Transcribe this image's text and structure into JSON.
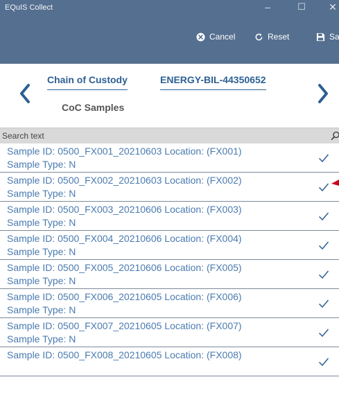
{
  "window": {
    "title": "EQuIS Collect",
    "controls": {
      "minimize": "–",
      "maximize": "☐",
      "close": "✕"
    }
  },
  "toolbar": {
    "cancel_label": "Cancel",
    "reset_label": "Reset",
    "save_label": "Save"
  },
  "header": {
    "tabs": [
      {
        "label": "Chain of Custody"
      },
      {
        "label": "ENERGY-BIL-44350652"
      }
    ],
    "subtitle": "CoC Samples"
  },
  "search": {
    "placeholder": "Search text",
    "value": ""
  },
  "samples": [
    {
      "line1": "Sample ID: 0500_FX001_20210603  Location: (FX001)",
      "line2": "Sample Type: N",
      "checked": true,
      "flagged": false
    },
    {
      "line1": "Sample ID: 0500_FX002_20210603  Location: (FX002)",
      "line2": "Sample Type: N",
      "checked": true,
      "flagged": true
    },
    {
      "line1": "Sample ID: 0500_FX003_20210606  Location: (FX003)",
      "line2": "Sample Type: N",
      "checked": true,
      "flagged": false
    },
    {
      "line1": "Sample ID: 0500_FX004_20210606  Location: (FX004)",
      "line2": "Sample Type: N",
      "checked": true,
      "flagged": false
    },
    {
      "line1": "Sample ID: 0500_FX005_20210606  Location: (FX005)",
      "line2": "Sample Type: N",
      "checked": true,
      "flagged": false
    },
    {
      "line1": "Sample ID: 0500_FX006_20210605  Location: (FX006)",
      "line2": "Sample Type: N",
      "checked": true,
      "flagged": false
    },
    {
      "line1": "Sample ID: 0500_FX007_20210605  Location: (FX007)",
      "line2": "Sample Type: N",
      "checked": true,
      "flagged": false
    },
    {
      "line1": "Sample ID: 0500_FX008_20210605  Location: (FX008)",
      "line2": "",
      "checked": true,
      "flagged": false
    }
  ],
  "colors": {
    "banner": "#556f90",
    "accent_blue": "#2d5f93",
    "row_text": "#4a7bb0",
    "flag": "#d0021b"
  },
  "icons": {
    "cancel": "x-circle-icon",
    "reset": "reset-icon",
    "save": "save-icon",
    "prev": "chevron-left-icon",
    "next": "chevron-right-icon",
    "search": "search-icon",
    "row_status": "check-icon",
    "row_flag": "flag-icon"
  }
}
